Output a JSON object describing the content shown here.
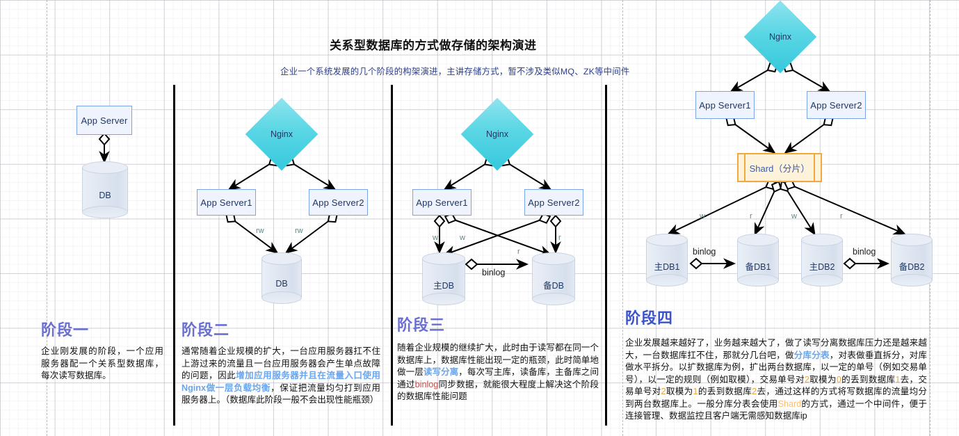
{
  "header": {
    "title": "关系型数据库的方式做存储的架构演进",
    "subtitle": "企业一个系统发展的几个阶段的构架演进，主讲存储方式，暂不涉及类似MQ、ZK等中间件"
  },
  "stage1": {
    "title": "阶段一",
    "nodes": {
      "app_server": "App Server",
      "db": "DB"
    },
    "body_parts": [
      {
        "t": "企业刚发展的阶段，一个应用服务器配一个关系型数据库，每次读写数据库。",
        "c": ""
      }
    ]
  },
  "stage2": {
    "title": "阶段二",
    "nodes": {
      "nginx": "Nginx",
      "app_server1": "App Server1",
      "app_server2": "App Server2",
      "db": "DB"
    },
    "edge_labels": {
      "rw_left": "rw",
      "rw_right": "rw"
    },
    "body_parts": [
      {
        "t": "通常随着企业规模的扩大，一台应用服务器扛不住上游过来的流量且一台应用服务器会产生单点故障的问题，因此",
        "c": ""
      },
      {
        "t": "增加应用服务器并且在流量入口使用Nginx做一层负载均衡",
        "c": "hl-blue"
      },
      {
        "t": "，保证把流量均匀打到应用服务器上。（数据库此阶段一般不会出现性能瓶颈）",
        "c": ""
      }
    ]
  },
  "stage3": {
    "title": "阶段三",
    "nodes": {
      "nginx": "Nginx",
      "app_server1": "App Server1",
      "app_server2": "App Server2",
      "master_db": "主DB",
      "slave_db": "备DB"
    },
    "edge_labels": {
      "w1": "w",
      "w2": "w",
      "r1": "r",
      "r2": "r",
      "binlog": "binlog"
    },
    "body_parts": [
      {
        "t": "随着企业规模的继续扩大，此时由于读写都在同一个数据库上，数据库性能出现一定的瓶颈，此时简单地做一层",
        "c": ""
      },
      {
        "t": "读写分离",
        "c": "hl-blue"
      },
      {
        "t": "，每次写主库，读备库，主备库之间通过",
        "c": ""
      },
      {
        "t": "binlog",
        "c": "hl-red"
      },
      {
        "t": "同步数据，就能很大程度上解决这个阶段的数据库性能问题",
        "c": ""
      }
    ]
  },
  "stage4": {
    "title": "阶段四",
    "nodes": {
      "nginx": "Nginx",
      "app_server1": "App Server1",
      "app_server2": "App Server2",
      "shard": "Shard（分片）",
      "master_db1": "主DB1",
      "slave_db1": "备DB1",
      "master_db2": "主DB2",
      "slave_db2": "备DB2"
    },
    "edge_labels": {
      "w1": "w",
      "r1": "r",
      "w2": "w",
      "r2": "r",
      "binlog1": "binlog",
      "binlog2": "binlog"
    },
    "body_parts": [
      {
        "t": "企业发展越来越好了，业务越来越大了，做了读写分离数据库压力还是越来越大，一台数据库扛不住，那就分几台吧，做",
        "c": ""
      },
      {
        "t": "分库分表",
        "c": "hl-blue"
      },
      {
        "t": "，对表做垂直拆分，对库做水平拆分。以扩数据库为例，扩出两台数据库，以一定的单号（例如交易单号），以一定的规则（例如取模），交易单号对",
        "c": ""
      },
      {
        "t": "2",
        "c": "hl-orange"
      },
      {
        "t": "取模为",
        "c": ""
      },
      {
        "t": "0",
        "c": "hl-orange"
      },
      {
        "t": "的丢到数据库",
        "c": ""
      },
      {
        "t": "1",
        "c": "hl-orange"
      },
      {
        "t": "去，交易单号对",
        "c": ""
      },
      {
        "t": "2",
        "c": "hl-orange"
      },
      {
        "t": "取模为",
        "c": ""
      },
      {
        "t": "1",
        "c": "hl-orange"
      },
      {
        "t": "的丢到数据库",
        "c": ""
      },
      {
        "t": "2",
        "c": "hl-orange"
      },
      {
        "t": "去，通过这样的方式将写数据库的流量均分到两台数据库上。一般分库分表会使用",
        "c": ""
      },
      {
        "t": "Shard",
        "c": "hl-orange-light"
      },
      {
        "t": "的方式，通过一个中间件，便于连接管理、数据监控且客户端无需感知数据库ip",
        "c": ""
      }
    ]
  },
  "colors": {
    "node_fill": "#eef3fd",
    "node_border": "#7aa3e8",
    "node_text": "#1f3864",
    "diamond": "#4fd2e2",
    "shard_fill": "#fdf3da",
    "shard_border": "#f2a93b",
    "cylinder_fill": "#dfe6f1",
    "title_purple": "#6a6fd0",
    "title_blue": "#3a53c8",
    "highlight_blue": "#69a6ee",
    "edge_label": "#5f8787"
  }
}
